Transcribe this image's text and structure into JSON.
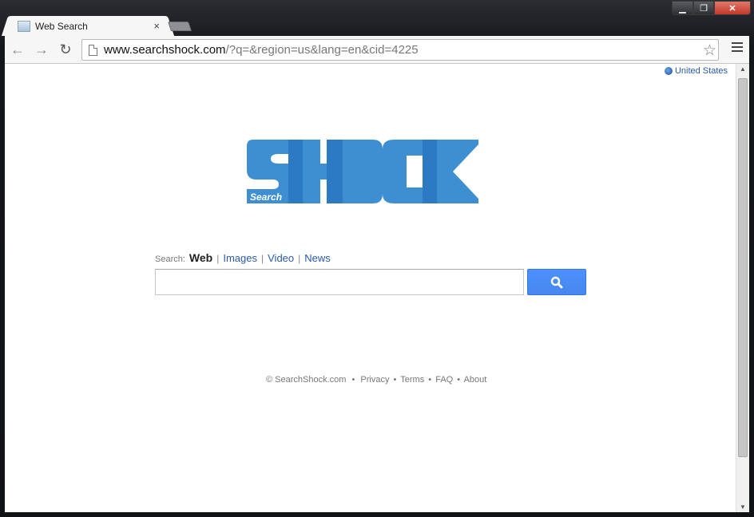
{
  "window": {
    "controls": {
      "minimize": "▁",
      "maximize": "❐",
      "close": "✕"
    }
  },
  "tab": {
    "title": "Web Search",
    "close": "×"
  },
  "toolbar": {
    "back_icon": "←",
    "forward_icon": "→",
    "reload_icon": "↻",
    "url_host": "www.searchshock.com",
    "url_rest": "/?q=&region=us&lang=en&cid=4225",
    "star_icon": "☆"
  },
  "region": {
    "label": "United States"
  },
  "logo": {
    "search_word": "Search",
    "brand_color": "#3d8fd1",
    "brand_dark": "#2b7ac3"
  },
  "search": {
    "label": "Search:",
    "types": [
      {
        "label": "Web"
      },
      {
        "label": "Images"
      },
      {
        "label": "Video"
      },
      {
        "label": "News"
      }
    ],
    "separator": "|",
    "input_value": "",
    "button_icon": "search-icon"
  },
  "footer": {
    "copyright": "© SearchShock.com",
    "links": [
      "Privacy",
      "Terms",
      "FAQ",
      "About"
    ],
    "bullet": "•"
  },
  "scrollbar": {
    "up": "▲",
    "down": "▼"
  }
}
